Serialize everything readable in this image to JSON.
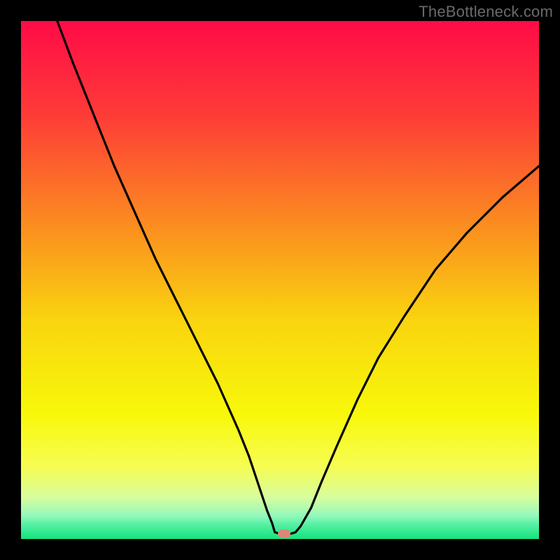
{
  "watermark": "TheBottleneck.com",
  "chart_data": {
    "type": "line",
    "title": "",
    "xlabel": "",
    "ylabel": "",
    "xlim": [
      0,
      100
    ],
    "ylim": [
      0,
      100
    ],
    "background": {
      "type": "vertical-gradient",
      "stops": [
        {
          "pos": 0.0,
          "color": "#ff0b47"
        },
        {
          "pos": 0.18,
          "color": "#fe3b37"
        },
        {
          "pos": 0.4,
          "color": "#fb8f1f"
        },
        {
          "pos": 0.58,
          "color": "#f9d50f"
        },
        {
          "pos": 0.76,
          "color": "#f8f80a"
        },
        {
          "pos": 0.86,
          "color": "#f6fd52"
        },
        {
          "pos": 0.92,
          "color": "#d7fd9f"
        },
        {
          "pos": 0.955,
          "color": "#93f8bc"
        },
        {
          "pos": 0.975,
          "color": "#4def9f"
        },
        {
          "pos": 1.0,
          "color": "#14e37e"
        }
      ]
    },
    "marker": {
      "x": 50.8,
      "y": 1.0,
      "color": "#dd8677"
    },
    "series": [
      {
        "name": "bottleneck-curve",
        "color": "#000000",
        "x": [
          7,
          10,
          14,
          18,
          22,
          26,
          30,
          34,
          38,
          42,
          44,
          46,
          47.5,
          48.5,
          49,
          50,
          52,
          53,
          54,
          56,
          58,
          61,
          65,
          69,
          74,
          80,
          86,
          93,
          100
        ],
        "y": [
          100,
          92,
          82,
          72,
          63,
          54,
          46,
          38,
          30,
          21,
          16,
          10,
          5.5,
          3,
          1.3,
          1,
          1,
          1.3,
          2.5,
          6,
          11,
          18,
          27,
          35,
          43,
          52,
          59,
          66,
          72
        ]
      }
    ]
  }
}
